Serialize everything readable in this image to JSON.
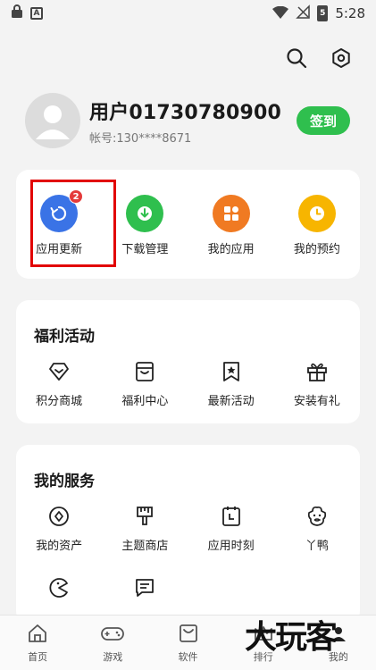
{
  "status_bar": {
    "time": "5:28",
    "battery": "5",
    "icon_a": "A"
  },
  "profile": {
    "username": "用户01730780900",
    "account": "帐号:130****8671",
    "signin_label": "签到"
  },
  "quick_actions": [
    {
      "label": "应用更新",
      "icon": "refresh-icon",
      "color": "#3a73e6",
      "badge": "2"
    },
    {
      "label": "下载管理",
      "icon": "download-icon",
      "color": "#2fbf4e"
    },
    {
      "label": "我的应用",
      "icon": "apps-icon",
      "color": "#f07a22"
    },
    {
      "label": "我的预约",
      "icon": "clock-icon",
      "color": "#f7b500"
    }
  ],
  "welfare": {
    "title": "福利活动",
    "items": [
      {
        "label": "积分商城",
        "icon": "diamond-icon"
      },
      {
        "label": "福利中心",
        "icon": "bag-icon"
      },
      {
        "label": "最新活动",
        "icon": "star-bookmark-icon"
      },
      {
        "label": "安装有礼",
        "icon": "gift-icon"
      }
    ]
  },
  "services": {
    "title": "我的服务",
    "items": [
      {
        "label": "我的资产",
        "icon": "coin-icon"
      },
      {
        "label": "主题商店",
        "icon": "brush-icon"
      },
      {
        "label": "应用时刻",
        "icon": "calendar-icon"
      },
      {
        "label": "丫鸭",
        "icon": "duck-icon"
      },
      {
        "label": "",
        "icon": "pacman-icon"
      },
      {
        "label": "",
        "icon": "message-icon"
      }
    ]
  },
  "bottom_nav": [
    {
      "label": "首页",
      "icon": "home-icon"
    },
    {
      "label": "游戏",
      "icon": "gamepad-icon"
    },
    {
      "label": "软件",
      "icon": "box-icon"
    },
    {
      "label": "排行",
      "icon": "crown-icon"
    },
    {
      "label": "我的",
      "icon": "profile-icon"
    }
  ],
  "watermark": "大玩客"
}
